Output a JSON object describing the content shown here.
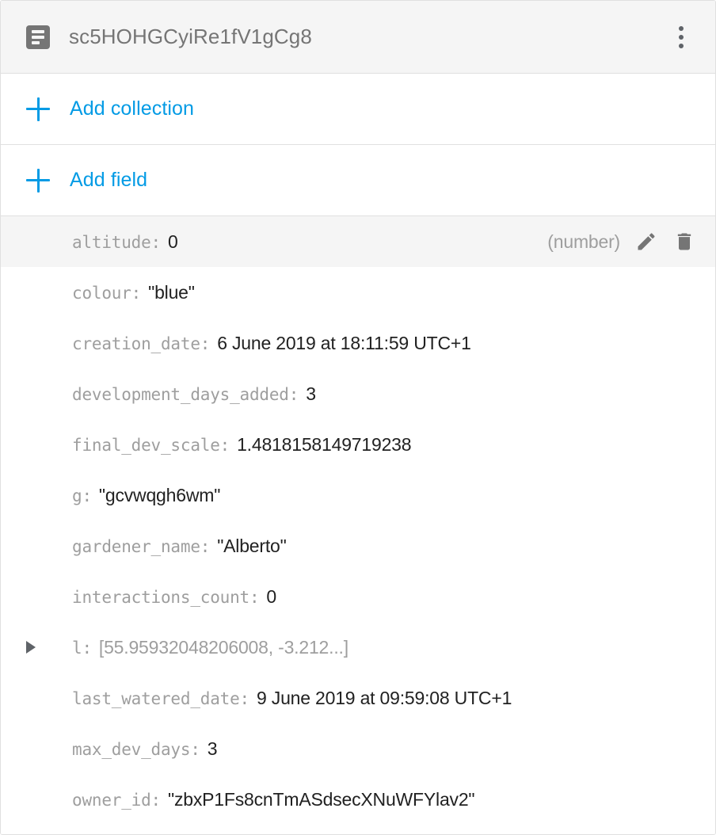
{
  "header": {
    "doc_icon": "document-icon",
    "title": "sc5HOHGCyiRe1fV1gCg8",
    "menu_icon": "overflow-menu-icon"
  },
  "actions": [
    {
      "icon": "plus-icon",
      "label": "Add collection",
      "name": "add-collection"
    },
    {
      "icon": "plus-icon",
      "label": "Add field",
      "name": "add-field"
    }
  ],
  "row_actions": {
    "type_label": "(number)",
    "edit_icon": "pencil-icon",
    "delete_icon": "trash-icon"
  },
  "fields": [
    {
      "key": "altitude:",
      "value": "0",
      "value_muted": false,
      "expandable": false,
      "selected": true,
      "type": "(number)"
    },
    {
      "key": "colour:",
      "value": "\"blue\"",
      "value_muted": false,
      "expandable": false,
      "selected": false
    },
    {
      "key": "creation_date:",
      "value": "6 June 2019 at 18:11:59 UTC+1",
      "value_muted": false,
      "expandable": false,
      "selected": false
    },
    {
      "key": "development_days_added:",
      "value": "3",
      "value_muted": false,
      "expandable": false,
      "selected": false
    },
    {
      "key": "final_dev_scale:",
      "value": "1.4818158149719238",
      "value_muted": false,
      "expandable": false,
      "selected": false
    },
    {
      "key": "g:",
      "value": "\"gcvwqgh6wm\"",
      "value_muted": false,
      "expandable": false,
      "selected": false
    },
    {
      "key": "gardener_name:",
      "value": "\"Alberto\"",
      "value_muted": false,
      "expandable": false,
      "selected": false
    },
    {
      "key": "interactions_count:",
      "value": "0",
      "value_muted": false,
      "expandable": false,
      "selected": false
    },
    {
      "key": "l:",
      "value": "[55.95932048206008, -3.212...]",
      "value_muted": true,
      "expandable": true,
      "selected": false
    },
    {
      "key": "last_watered_date:",
      "value": "9 June 2019 at 09:59:08 UTC+1",
      "value_muted": false,
      "expandable": false,
      "selected": false
    },
    {
      "key": "max_dev_days:",
      "value": "3",
      "value_muted": false,
      "expandable": false,
      "selected": false
    },
    {
      "key": "owner_id:",
      "value": "\"zbxP1Fs8cnTmASdsecXNuWFYlav2\"",
      "value_muted": false,
      "expandable": false,
      "selected": false
    }
  ],
  "colors": {
    "accent": "#039be5",
    "key_text": "#9e9e9e",
    "value_text": "#212121",
    "header_bg": "#f5f5f5",
    "selected_row_bg": "#f5f5f5",
    "border": "#e0e0e0",
    "icon_gray": "#757575"
  }
}
